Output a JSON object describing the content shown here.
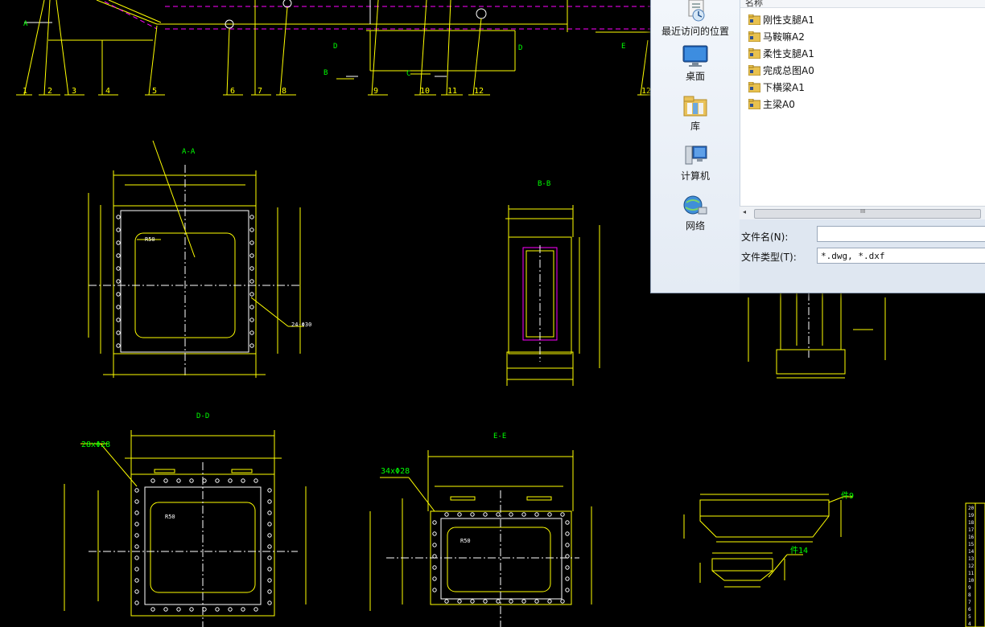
{
  "drawing": {
    "balloons": [
      "1",
      "2",
      "3",
      "4",
      "5",
      "6",
      "7",
      "8",
      "9",
      "10",
      "11",
      "12"
    ],
    "balloon_right": "12",
    "section_markers": {
      "a": "A",
      "b": "B",
      "c": "C",
      "d_left": "D",
      "d_right": "D",
      "e": "E"
    },
    "views": {
      "aa": {
        "title": "A-A",
        "radius": "R50",
        "holes": "24-Φ30"
      },
      "bb": {
        "title": "B-B"
      },
      "dd": {
        "title": "D-D",
        "holes": "28xΦ28",
        "radius": "R50"
      },
      "ee": {
        "title": "E-E",
        "holes": "34xΦ28",
        "radius": "R50"
      }
    },
    "part_labels": {
      "part9": "件9",
      "part14": "件14"
    },
    "title_block_rows": [
      "20",
      "19",
      "18",
      "17",
      "16",
      "15",
      "14",
      "13",
      "12",
      "11",
      "10",
      "9",
      "8",
      "7",
      "6",
      "5",
      "4"
    ]
  },
  "dialog": {
    "column_header": "名称",
    "places": [
      {
        "label": "最近访问的位置",
        "icon": "recent-places-icon"
      },
      {
        "label": "桌面",
        "icon": "desktop-icon"
      },
      {
        "label": "库",
        "icon": "libraries-icon"
      },
      {
        "label": "计算机",
        "icon": "computer-icon"
      },
      {
        "label": "网络",
        "icon": "network-icon"
      }
    ],
    "files": [
      {
        "name": "刚性支腿A1"
      },
      {
        "name": "马鞍嘛A2"
      },
      {
        "name": "柔性支腿A1"
      },
      {
        "name": "完成总图A0"
      },
      {
        "name": "下横梁A1"
      },
      {
        "name": "主梁A0"
      }
    ],
    "filename_label": "文件名(N):",
    "filename_value": "",
    "filetype_label": "文件类型(T):",
    "filetype_value": "*.dwg, *.dxf",
    "scroll_grip": "III"
  },
  "colors": {
    "yellow": "#ffff00",
    "magenta": "#ff00ff",
    "white": "#ffffff",
    "green": "#00ff00",
    "dialog_bg": "#dfe7f1"
  }
}
